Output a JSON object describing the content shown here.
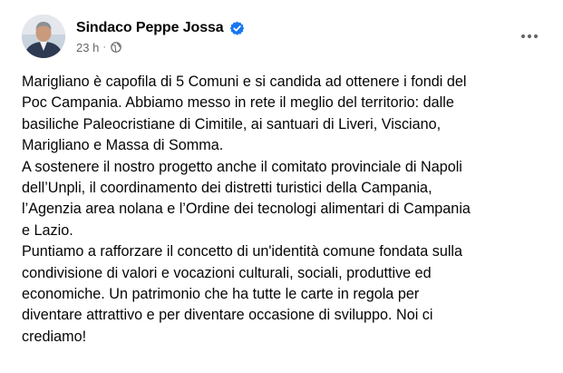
{
  "post": {
    "author": "Sindaco Peppe Jossa",
    "time": "23 h",
    "separator": "·",
    "verified_icon": "verified-badge-icon",
    "audience_icon": "globe-icon",
    "more_icon": "more-options-icon",
    "lines": [
      "Marigliano è capofila di 5 Comuni e si candida ad ottenere i fondi del",
      "Poc Campania. Abbiamo messo in rete il meglio del  territorio: dalle",
      "basiliche Paleocristiane di Cimitile, ai santuari di Liveri, Visciano,",
      "Marigliano e Massa di Somma.",
      "A sostenere il nostro progetto anche il comitato provinciale di Napoli",
      "dell’Unpli, il coordinamento dei distretti turistici della Campania,",
      "l’Agenzia area nolana e l’Ordine dei tecnologi alimentari di Campania",
      "e Lazio.",
      "Puntiamo a rafforzare il concetto di un'identità comune fondata sulla",
      "condivisione di valori e vocazioni culturali, sociali, produttive ed",
      "economiche. Un patrimonio che ha tutte le carte in regola per",
      "diventare attrattivo e per diventare occasione di sviluppo. Noi ci",
      "crediamo!"
    ]
  },
  "colors": {
    "text": "#050505",
    "secondary_text": "#65676b",
    "verified_blue": "#1877f2"
  }
}
